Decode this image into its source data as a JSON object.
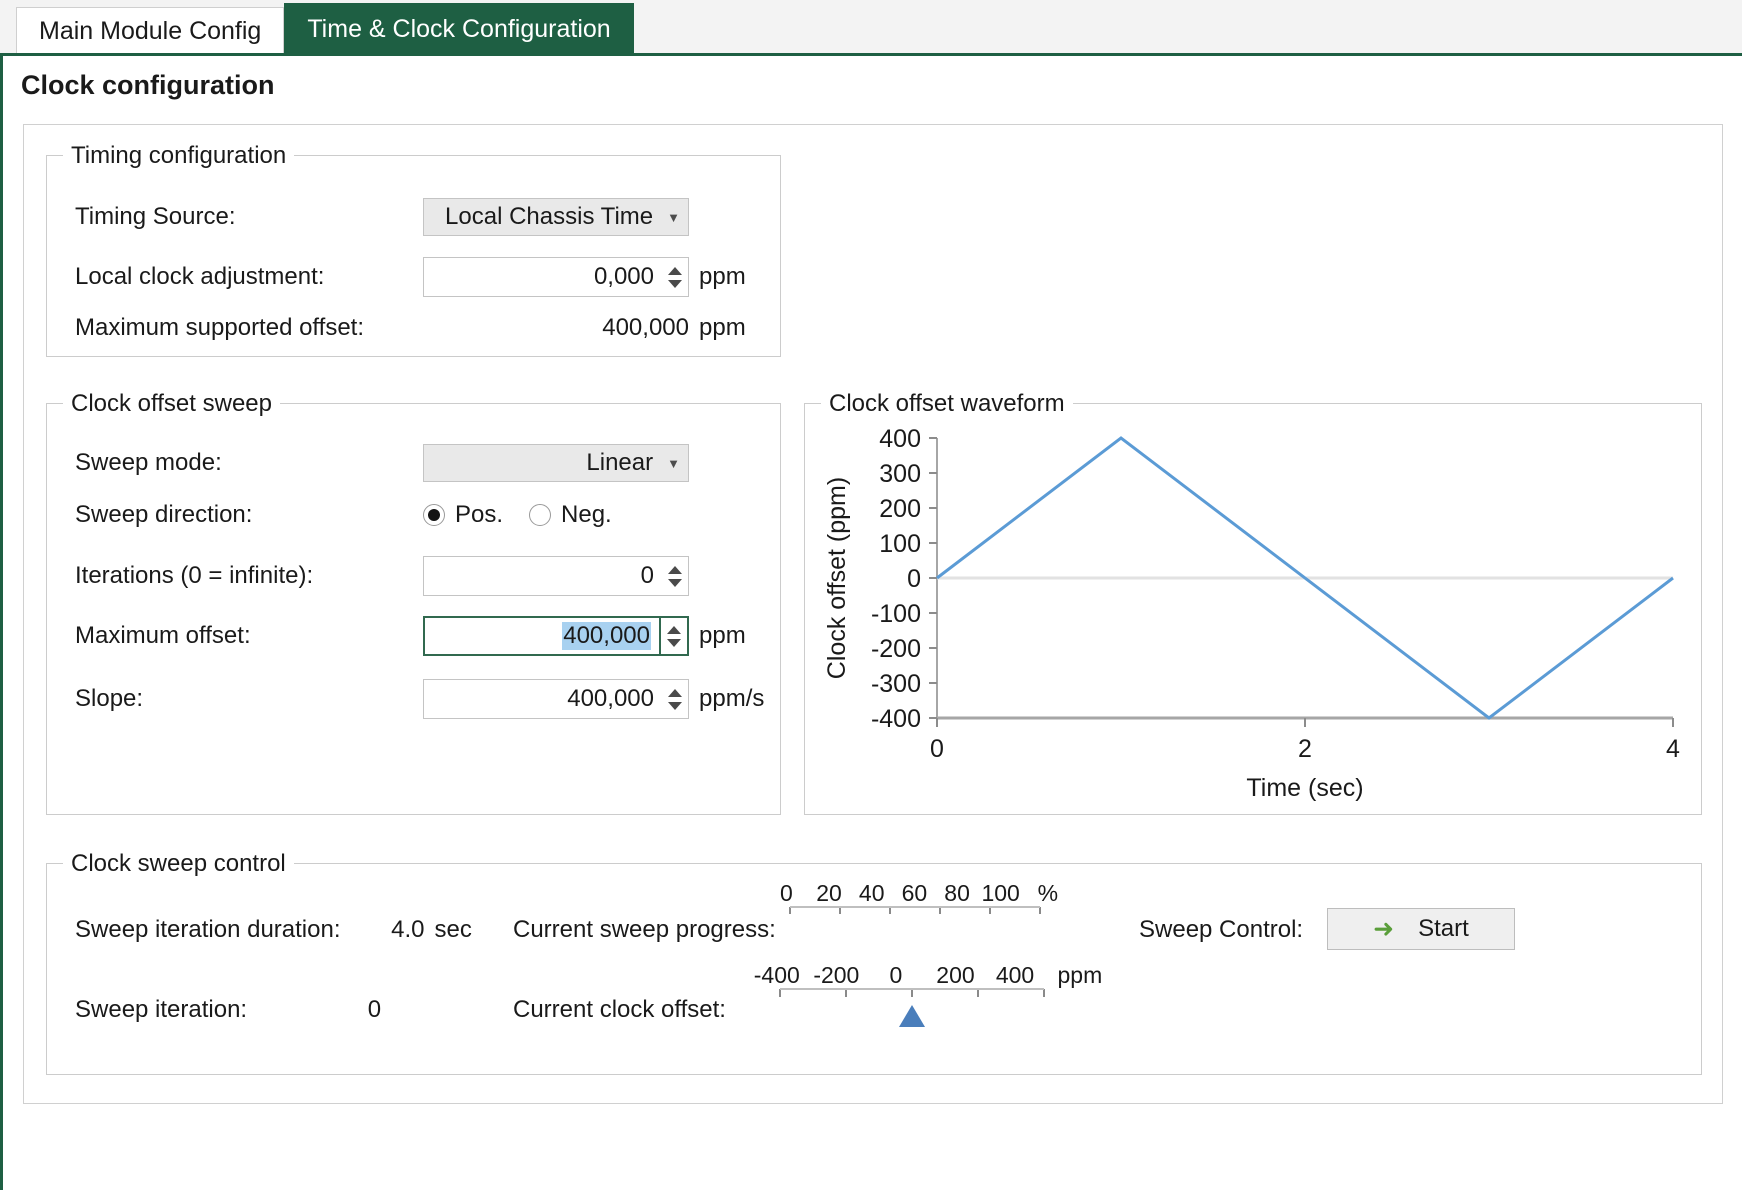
{
  "tabs": [
    {
      "label": "Main Module Config",
      "active": false
    },
    {
      "label": "Time & Clock Configuration",
      "active": true
    }
  ],
  "page_title": "Clock configuration",
  "accent_color": "#1e5f43",
  "groups": {
    "timing": {
      "legend": "Timing configuration",
      "timing_source": {
        "label": "Timing Source:",
        "value": "Local Chassis Time",
        "caret": "chevron-down-icon"
      },
      "local_clock_adjustment": {
        "label": "Local clock adjustment:",
        "value": "0,000",
        "unit": "ppm"
      },
      "maximum_supported_offset": {
        "label": "Maximum supported offset:",
        "value": "400,000",
        "unit": "ppm"
      }
    },
    "sweep": {
      "legend": "Clock offset sweep",
      "sweep_mode": {
        "label": "Sweep mode:",
        "value": "Linear",
        "caret": "chevron-down-icon"
      },
      "sweep_direction": {
        "label": "Sweep direction:",
        "options": [
          {
            "label": "Pos.",
            "selected": true
          },
          {
            "label": "Neg.",
            "selected": false
          }
        ]
      },
      "iterations": {
        "label": "Iterations (0 = infinite):",
        "value": "0"
      },
      "maximum_offset": {
        "label": "Maximum offset:",
        "value": "400,000",
        "unit": "ppm",
        "focused": true,
        "text_selected": true
      },
      "slope": {
        "label": "Slope:",
        "value": "400,000",
        "unit": "ppm/s"
      }
    },
    "waveform": {
      "legend": "Clock offset waveform"
    },
    "control": {
      "legend": "Clock sweep control",
      "sweep_iteration_duration": {
        "label": "Sweep iteration duration:",
        "value": "4.0",
        "unit": "sec"
      },
      "sweep_iteration": {
        "label": "Sweep iteration:",
        "value": "0"
      },
      "current_sweep_progress": {
        "label": "Current sweep progress:",
        "ticks": [
          "0",
          "20",
          "40",
          "60",
          "80",
          "100"
        ],
        "unit": "%",
        "value": 0
      },
      "current_clock_offset": {
        "label": "Current clock offset:",
        "ticks": [
          "-400",
          "-200",
          "0",
          "200",
          "400"
        ],
        "unit": "ppm",
        "value": 0,
        "marker": "triangle-up-marker"
      },
      "sweep_control": {
        "label": "Sweep Control:",
        "button_label": "Start",
        "button_icon": "green-arrow-icon"
      }
    }
  },
  "chart_data": {
    "type": "line",
    "title": "Clock offset waveform",
    "xlabel": "Time (sec)",
    "ylabel": "Clock offset (ppm)",
    "xlim": [
      0,
      4
    ],
    "ylim": [
      -400,
      400
    ],
    "xticks": [
      "0",
      "2",
      "4"
    ],
    "yticks": [
      "400",
      "300",
      "200",
      "100",
      "0",
      "-100",
      "-200",
      "-300",
      "-400"
    ],
    "grid": false,
    "legend": "none",
    "series": [
      {
        "name": "Clock offset",
        "color": "#5b9bd5",
        "x": [
          0,
          1,
          3,
          4
        ],
        "y": [
          0,
          400,
          -400,
          0
        ]
      }
    ]
  }
}
